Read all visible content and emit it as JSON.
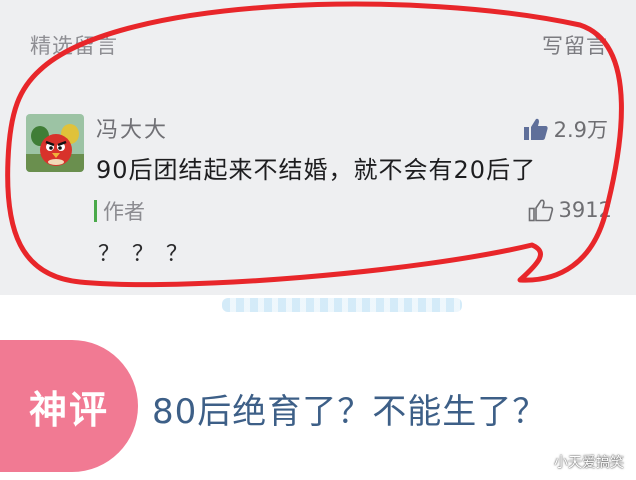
{
  "header": {
    "section_title": "精选留言",
    "write_comment": "写留言"
  },
  "comment": {
    "username": "冯大大",
    "likes": "2.9万",
    "text": "90后团结起来不结婚，就不会有20后了",
    "avatar_icon": "angry-birds-avatar-icon"
  },
  "author_reply": {
    "label": "作者",
    "likes": "3912",
    "text": "？？？"
  },
  "badge": {
    "label": "神评"
  },
  "god_comment": {
    "text": "80后绝育了？不能生了？"
  },
  "watermark": {
    "text": "小天爱搞笑"
  },
  "colors": {
    "annotation_red": "#e8262a",
    "badge_pink": "#f17a93",
    "god_comment_blue": "#3d5f87"
  }
}
